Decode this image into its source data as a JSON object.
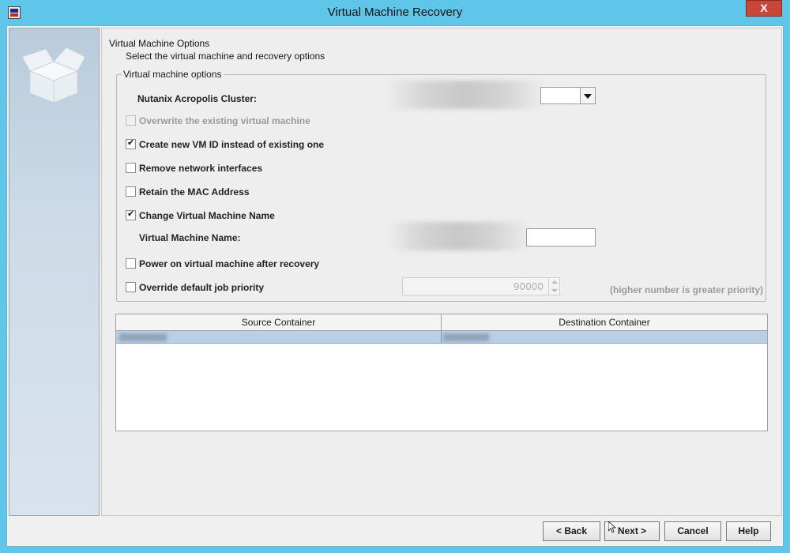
{
  "window": {
    "title": "Virtual Machine Recovery",
    "close_label": "X"
  },
  "page": {
    "heading": "Virtual Machine Options",
    "subheading": "Select the virtual machine and recovery options"
  },
  "vm_options": {
    "legend": "Virtual machine options",
    "cluster_label": "Nutanix Acropolis Cluster:",
    "overwrite": {
      "label": "Overwrite the existing virtual machine",
      "checked": false,
      "enabled": false
    },
    "new_vm_id": {
      "label": "Create new VM ID instead of existing one",
      "checked": true
    },
    "remove_nics": {
      "label": "Remove network interfaces",
      "checked": false
    },
    "retain_mac": {
      "label": "Retain the MAC Address",
      "checked": false
    },
    "change_name": {
      "label": "Change Virtual Machine Name",
      "checked": true
    },
    "vm_name_label": "Virtual Machine Name:",
    "power_on": {
      "label": "Power on virtual machine after recovery",
      "checked": false
    },
    "override_priority": {
      "label": "Override default job priority",
      "checked": false
    },
    "priority_value": "90000",
    "priority_hint": "(higher number is greater priority)"
  },
  "table": {
    "columns": [
      "Source Container",
      "Destination Container"
    ]
  },
  "buttons": {
    "back": "< Back",
    "next": "Next >",
    "cancel": "Cancel",
    "help": "Help"
  }
}
